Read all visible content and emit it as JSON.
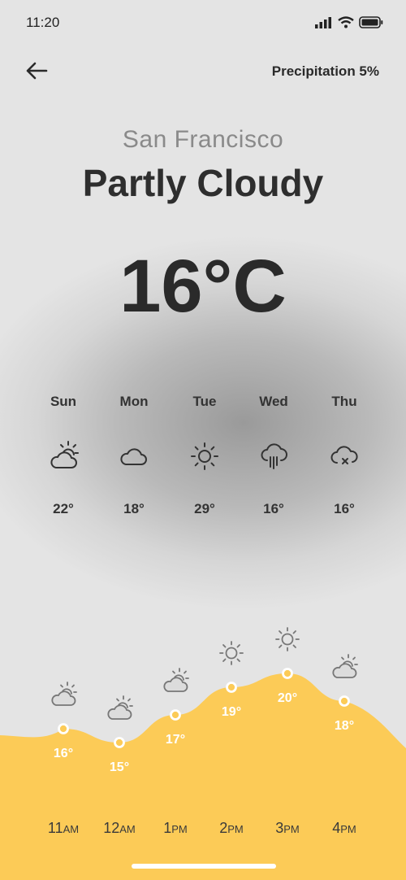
{
  "status": {
    "time": "11:20"
  },
  "header": {
    "precipitation": "Precipitation 5%"
  },
  "location": {
    "city": "San Francisco",
    "condition": "Partly Cloudy",
    "temperature": "16°C"
  },
  "daily": [
    {
      "day": "Sun",
      "icon": "partly-cloudy-icon",
      "temp": "22°"
    },
    {
      "day": "Mon",
      "icon": "cloud-icon",
      "temp": "18°"
    },
    {
      "day": "Tue",
      "icon": "sun-icon",
      "temp": "29°"
    },
    {
      "day": "Wed",
      "icon": "rain-cloud-icon",
      "temp": "16°"
    },
    {
      "day": "Thu",
      "icon": "cloud-x-icon",
      "temp": "16°"
    }
  ],
  "hourly": [
    {
      "hour": "11",
      "ampm": "AM",
      "icon": "partly-cloudy-icon",
      "temp": "16°",
      "value": 16
    },
    {
      "hour": "12",
      "ampm": "AM",
      "icon": "partly-cloudy-icon",
      "temp": "15°",
      "value": 15
    },
    {
      "hour": "1",
      "ampm": "PM",
      "icon": "partly-cloudy-icon",
      "temp": "17°",
      "value": 17
    },
    {
      "hour": "2",
      "ampm": "PM",
      "icon": "sun-icon",
      "temp": "19°",
      "value": 19
    },
    {
      "hour": "3",
      "ampm": "PM",
      "icon": "sun-icon",
      "temp": "20°",
      "value": 20
    },
    {
      "hour": "4",
      "ampm": "PM",
      "icon": "partly-cloudy-icon",
      "temp": "18°",
      "value": 18
    }
  ],
  "colors": {
    "accent": "#FCCB57",
    "text": "#2E2E2E",
    "muted": "#8A8A8A"
  }
}
